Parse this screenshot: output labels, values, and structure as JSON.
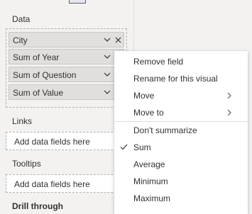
{
  "sections": {
    "data": {
      "title": "Data"
    },
    "links": {
      "title": "Links",
      "placeholder": "Add data fields here"
    },
    "tooltips": {
      "title": "Tooltips",
      "placeholder": "Add data fields here"
    },
    "drill": {
      "title": "Drill through"
    }
  },
  "fields": [
    {
      "label": "City"
    },
    {
      "label": "Sum of Year"
    },
    {
      "label": "Sum of Question"
    },
    {
      "label": "Sum of Value"
    }
  ],
  "menu": {
    "items": [
      {
        "label": "Remove field"
      },
      {
        "label": "Rename for this visual"
      },
      {
        "label": "Move",
        "submenu": true
      },
      {
        "label": "Move to",
        "submenu": true
      },
      {
        "label": "Don't summarize"
      },
      {
        "label": "Sum",
        "checked": true
      },
      {
        "label": "Average"
      },
      {
        "label": "Minimum"
      },
      {
        "label": "Maximum"
      }
    ]
  },
  "icons": {
    "chevron": "chevron-down-icon",
    "remove": "close-icon",
    "submenu": "chevron-right-icon",
    "check": "checkmark-icon"
  }
}
